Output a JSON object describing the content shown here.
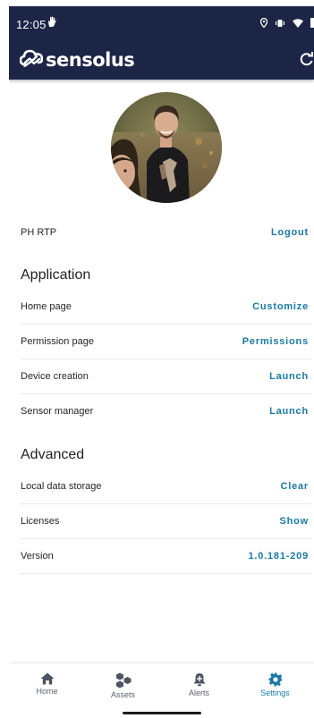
{
  "status_bar": {
    "time": "12:05"
  },
  "app_bar": {
    "brand": "sensolus"
  },
  "profile": {
    "user_name": "PH RTP",
    "logout_label": "Logout"
  },
  "application": {
    "title": "Application",
    "rows": [
      {
        "label": "Home page",
        "action": "Customize"
      },
      {
        "label": "Permission page",
        "action": "Permissions"
      },
      {
        "label": "Device creation",
        "action": "Launch"
      },
      {
        "label": "Sensor manager",
        "action": "Launch"
      }
    ]
  },
  "advanced": {
    "title": "Advanced",
    "rows": [
      {
        "label": "Local data storage",
        "action": "Clear"
      },
      {
        "label": "Licenses",
        "action": "Show"
      },
      {
        "label": "Version",
        "action": "1.0.181-209"
      }
    ]
  },
  "bottom_nav": {
    "items": [
      {
        "label": "Home",
        "icon": "home-icon"
      },
      {
        "label": "Assets",
        "icon": "assets-hexagons-icon"
      },
      {
        "label": "Alerts",
        "icon": "alert-bell-icon"
      },
      {
        "label": "Settings",
        "icon": "settings-gear-icon"
      }
    ],
    "active": "Settings"
  },
  "colors": {
    "header_bg": "#1d2547",
    "accent": "#1a7aa5",
    "text": "#262626"
  }
}
